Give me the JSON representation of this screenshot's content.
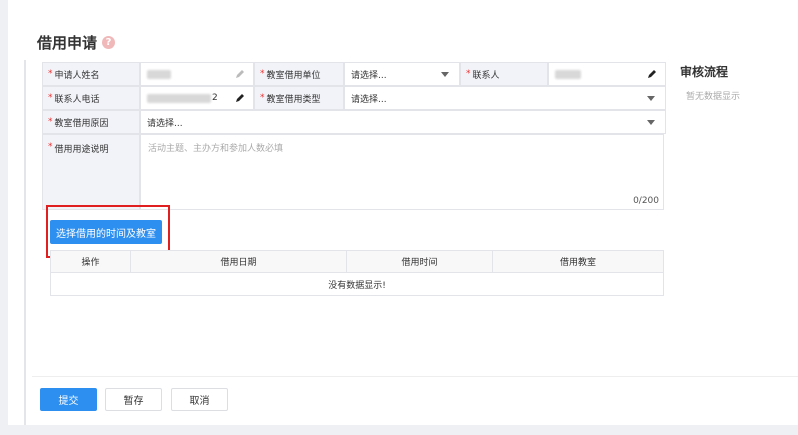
{
  "page": {
    "title": "借用申请",
    "help_icon": "?"
  },
  "form": {
    "applicant_label": "申请人姓名",
    "unit_label": "教室借用单位",
    "unit_value": "请选择...",
    "contact_label": "联系人",
    "phone_label": "联系人电话",
    "phone_value_suffix": "2",
    "type_label": "教室借用类型",
    "type_value": "请选择...",
    "reason_label": "教室借用原因",
    "reason_value": "请选择...",
    "purpose_label": "借用用途说明",
    "purpose_placeholder": "活动主题、主办方和参加人数必填",
    "purpose_counter": "0/200",
    "required_mark": "*"
  },
  "select_button": "选择借用的时间及教室",
  "table": {
    "headers": [
      "操作",
      "借用日期",
      "借用时间",
      "借用教室"
    ],
    "empty_text": "没有数据显示!"
  },
  "sidebar": {
    "title": "审核流程",
    "empty_text": "暂无数据显示"
  },
  "footer": {
    "submit": "提交",
    "save": "暂存",
    "cancel": "取消"
  },
  "colors": {
    "primary": "#2d8ff0",
    "required": "#e33333",
    "highlight_border": "#e02020"
  }
}
